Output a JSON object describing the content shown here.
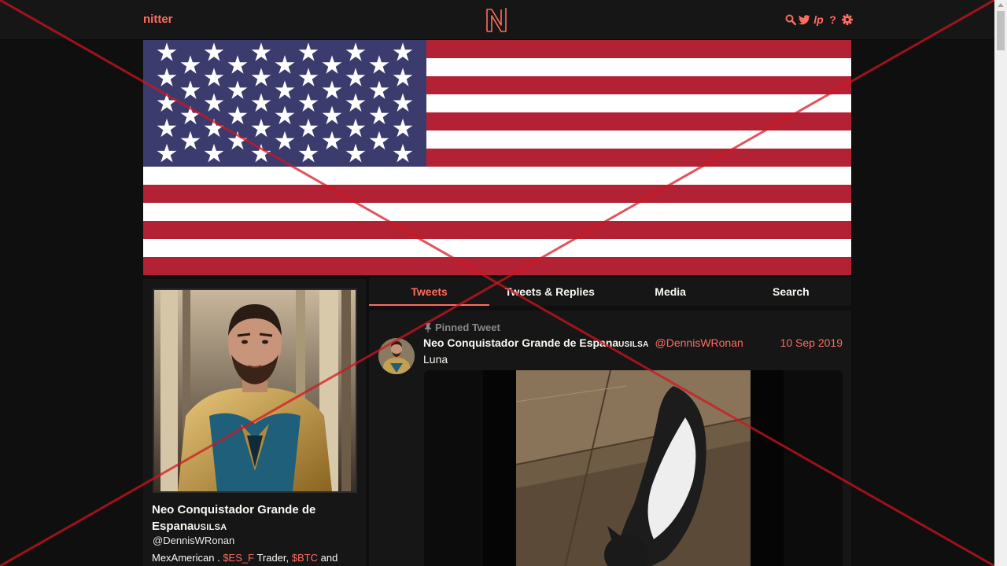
{
  "nav": {
    "brand": "nitter",
    "icons": [
      "search-icon",
      "bird-icon",
      "liberapay-icon",
      "question-icon",
      "gear-icon"
    ],
    "liberapay_text": "lp",
    "help_text": "?"
  },
  "profile": {
    "name": "Neo Conquistador Grande de Espana",
    "name_suffix": "USILSA",
    "handle": "@DennisWRonan",
    "bio": {
      "part1": "MexAmerican . ",
      "tag1": "$ES_F",
      "part2": " Trader, ",
      "tag2": "$BTC",
      "part3": " and"
    }
  },
  "tabs": [
    "Tweets",
    "Tweets & Replies",
    "Media",
    "Search"
  ],
  "active_tab": "Tweets",
  "tweet": {
    "pinned_label": "Pinned Tweet",
    "fullname": "Neo Conquistador Grande de Espana",
    "fullname_suffix": "USILSA",
    "username": "@DennisWRonan",
    "date": "10 Sep 2019",
    "text": "Luna"
  },
  "colors": {
    "accent": "#ff6c60",
    "background": "#0f0f0f",
    "panel": "#161616",
    "overlay": "#d4141e"
  }
}
